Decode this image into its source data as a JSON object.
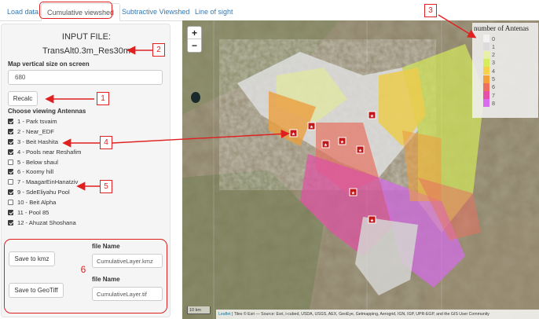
{
  "tabs": [
    {
      "label": "Load data"
    },
    {
      "label": "Cumulative viewshed"
    },
    {
      "label": "Subtractive Viewshed"
    },
    {
      "label": "Line of sight"
    }
  ],
  "sidebar": {
    "input_title": "INPUT FILE:",
    "input_file": "TransAlt0.3m_Res30m",
    "map_size_label": "Map vertical size on screen",
    "map_size_value": "680",
    "recalc_label": "Recalc",
    "choose_label": "Choose viewing Antennas",
    "antennas": [
      {
        "label": "1 - Park tsvaim",
        "checked": true
      },
      {
        "label": "2 - Near_EDF",
        "checked": true
      },
      {
        "label": "3 - Beit Hashita",
        "checked": true
      },
      {
        "label": "4 - Pools near Reshafim",
        "checked": true
      },
      {
        "label": "5 - Below shaul",
        "checked": false
      },
      {
        "label": "6 - Koomy hill",
        "checked": true
      },
      {
        "label": "7 - MaagarEinHanatziv",
        "checked": false
      },
      {
        "label": "9 - SdeEliyahu Pool",
        "checked": true
      },
      {
        "label": "10 - Beit Alpha",
        "checked": false
      },
      {
        "label": "11 - Pool 85",
        "checked": true
      },
      {
        "label": "12 - Ahuzat Shoshana",
        "checked": true
      }
    ],
    "save_kmz_label": "Save to kmz",
    "save_tiff_label": "Save to GeoTiff",
    "file_name_label_1": "file Name",
    "file_name_label_2": "file Name",
    "kmz_filename": "CumulativeLayer.kmz",
    "tif_filename": "CumulativeLayer.tif"
  },
  "annotations": [
    "1",
    "2",
    "3",
    "4",
    "5",
    "6"
  ],
  "map": {
    "zoom_in": "+",
    "zoom_out": "−",
    "legend_title": "number of Antenas",
    "legend": [
      {
        "label": "0",
        "color": "#f2f2f2"
      },
      {
        "label": "1",
        "color": "#dcdcdc"
      },
      {
        "label": "2",
        "color": "#e8f0a8"
      },
      {
        "label": "3",
        "color": "#d6ec5a"
      },
      {
        "label": "4",
        "color": "#f4d34a"
      },
      {
        "label": "5",
        "color": "#f5a13a"
      },
      {
        "label": "6",
        "color": "#ee6f5e"
      },
      {
        "label": "7",
        "color": "#e54fa8"
      },
      {
        "label": "8",
        "color": "#d86bf0"
      }
    ],
    "scale_label": "10 km",
    "attribution_leaflet": "Leaflet",
    "attribution_text": " | Tiles © Esri — Source: Esri, i-cubed, USDA, USGS, AEX, GeoEye, Getmapping, Aerogrid, IGN, IGP, UPR-EGP, and the GIS User Community"
  },
  "colors": {
    "annotation": "#e02020",
    "link": "#337ab7"
  }
}
